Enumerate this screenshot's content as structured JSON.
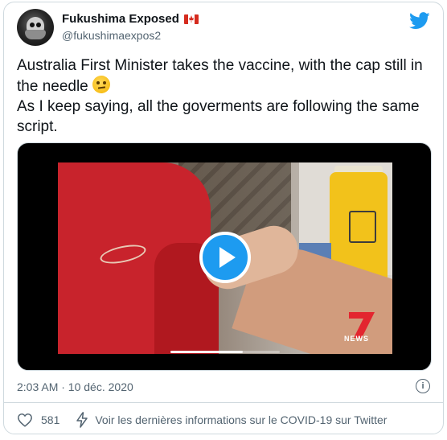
{
  "author": {
    "display_name": "Fukushima Exposed",
    "handle": "@fukushimaexpos2",
    "flag": "canada-flag"
  },
  "tweet": {
    "line1": "Australia First Minister takes the vaccine, with the cap still in the needle",
    "line2": "As I keep saying, all the goverments are following the same script.",
    "emoji": "face-with-rolling-eyes"
  },
  "media": {
    "type": "video",
    "overlay_text": "NEWS",
    "channel_logo": "7",
    "progress": 0.66
  },
  "meta": {
    "timestamp": "2:03 AM · 10 déc. 2020"
  },
  "footer": {
    "like_count": "581",
    "covid_link_text": "Voir les dernières informations sur le COVID-19 sur Twitter"
  },
  "colors": {
    "twitter_blue": "#1d9bf0",
    "secondary_text": "#536471",
    "border": "#cfd9de"
  }
}
